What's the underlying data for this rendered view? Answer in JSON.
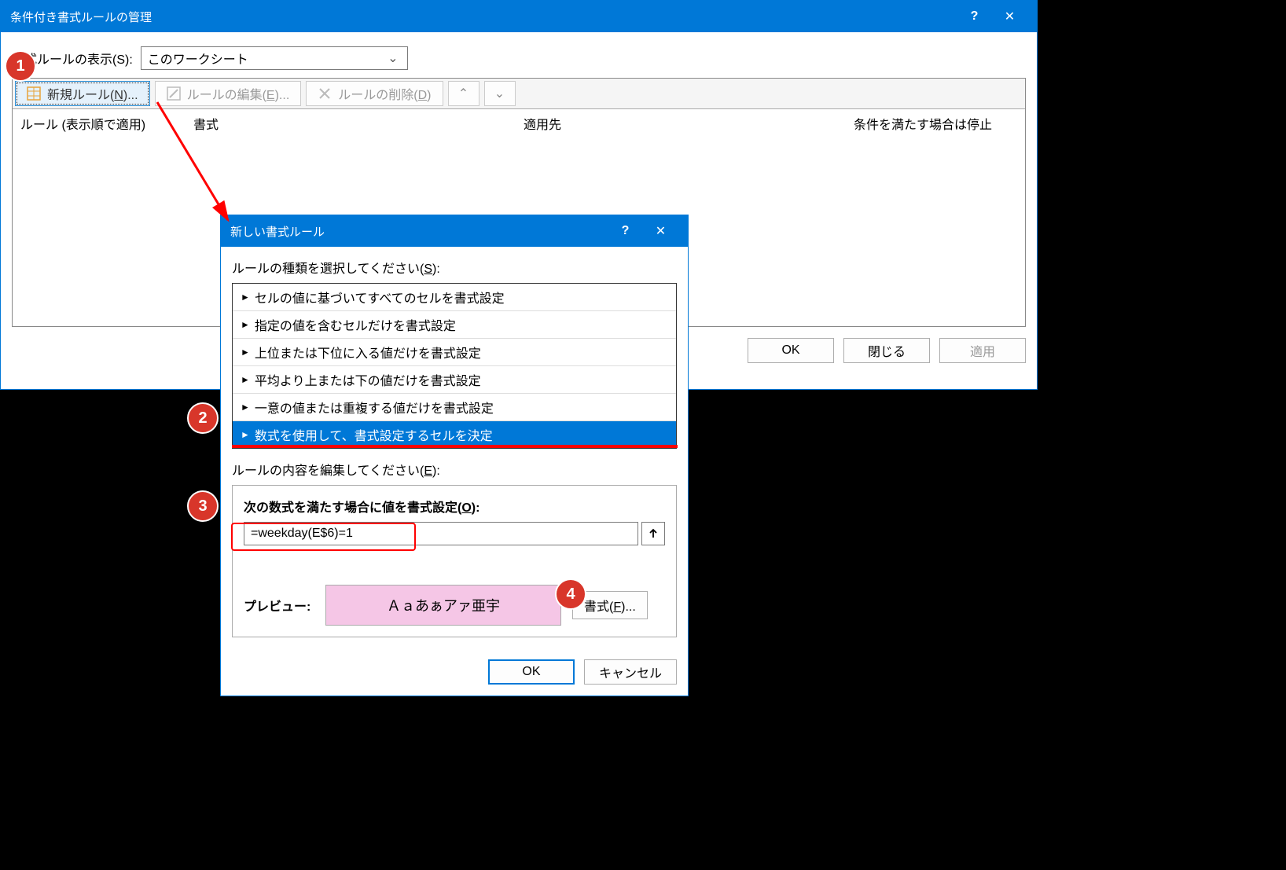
{
  "main": {
    "title": "条件付き書式ルールの管理",
    "show_label": "書式ルールの表示(S):",
    "dropdown_value": "このワークシート",
    "toolbar": {
      "new_rule": "新規ルール(N)...",
      "edit_rule": "ルールの編集(E)...",
      "delete_rule": "ルールの削除(D)"
    },
    "cols": {
      "c1": "ルール (表示順で適用)",
      "c2": "書式",
      "c3": "適用先",
      "c4": "条件を満たす場合は停止"
    },
    "buttons": {
      "ok": "OK",
      "close": "閉じる",
      "apply": "適用"
    }
  },
  "sub": {
    "title": "新しい書式ルール",
    "select_label": "ルールの種類を選択してください(S):",
    "rule_types": [
      "セルの値に基づいてすべてのセルを書式設定",
      "指定の値を含むセルだけを書式設定",
      "上位または下位に入る値だけを書式設定",
      "平均より上または下の値だけを書式設定",
      "一意の値または重複する値だけを書式設定",
      "数式を使用して、書式設定するセルを決定"
    ],
    "edit_label": "ルールの内容を編集してください(E):",
    "formula_label": "次の数式を満たす場合に値を書式設定(O):",
    "formula_value": "=weekday(E$6)=1",
    "preview_label": "プレビュー:",
    "preview_text": "Ａａあぁアァ亜宇",
    "format_btn": "書式(F)...",
    "ok": "OK",
    "cancel": "キャンセル"
  },
  "badges": {
    "b1": "1",
    "b2": "2",
    "b3": "3",
    "b4": "4"
  }
}
